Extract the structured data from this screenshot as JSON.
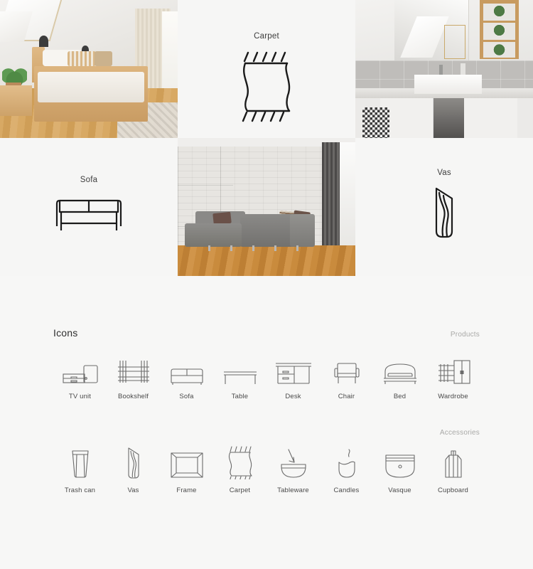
{
  "showcase": {
    "cells": [
      {
        "type": "photo",
        "name": "bedroom-photo",
        "alt": "Bedroom interior with wooden bed"
      },
      {
        "type": "icon",
        "name": "carpet",
        "label": "Carpet"
      },
      {
        "type": "photo",
        "name": "bathroom-photo",
        "alt": "Bathroom with white sink and mirror"
      },
      {
        "type": "icon",
        "name": "sofa",
        "label": "Sofa"
      },
      {
        "type": "photo",
        "name": "living-room-photo",
        "alt": "Living room with grey corner sofa"
      },
      {
        "type": "icon",
        "name": "vas",
        "label": "Vas"
      }
    ]
  },
  "panel": {
    "title": "Icons",
    "categories": {
      "products": "Products",
      "accessories": "Accessories"
    },
    "products": [
      {
        "icon": "tv-unit-icon",
        "label": "TV unit"
      },
      {
        "icon": "bookshelf-icon",
        "label": "Bookshelf"
      },
      {
        "icon": "sofa-icon",
        "label": "Sofa"
      },
      {
        "icon": "table-icon",
        "label": "Table"
      },
      {
        "icon": "desk-icon",
        "label": "Desk"
      },
      {
        "icon": "chair-icon",
        "label": "Chair"
      },
      {
        "icon": "bed-icon",
        "label": "Bed"
      },
      {
        "icon": "wardrobe-icon",
        "label": "Wardrobe"
      }
    ],
    "accessories": [
      {
        "icon": "trash-can-icon",
        "label": "Trash can"
      },
      {
        "icon": "vas-icon",
        "label": "Vas"
      },
      {
        "icon": "frame-icon",
        "label": "Frame"
      },
      {
        "icon": "carpet-icon",
        "label": "Carpet"
      },
      {
        "icon": "tableware-icon",
        "label": "Tableware"
      },
      {
        "icon": "candles-icon",
        "label": "Candles"
      },
      {
        "icon": "vasque-icon",
        "label": "Vasque"
      },
      {
        "icon": "cupboard-icon",
        "label": "Cupboard"
      }
    ]
  },
  "colors": {
    "background": "#f7f7f6",
    "tile_background": "#f6f6f5",
    "icon_stroke": "#1a1a1a",
    "small_icon_stroke": "#6b6b6b",
    "label_text": "#4a4a4a",
    "category_text": "#a9a9a7",
    "title_text": "#2f2f2f"
  }
}
